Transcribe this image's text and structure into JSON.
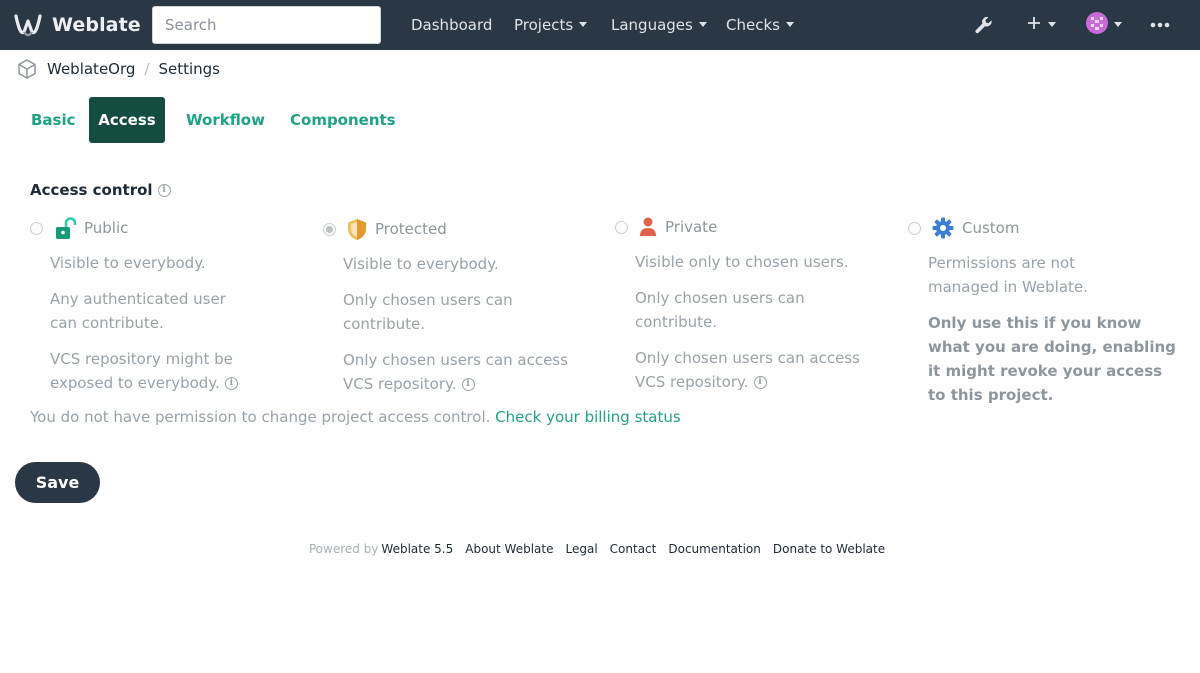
{
  "app": {
    "name": "Weblate",
    "logo_icon": "weblate-logo-icon"
  },
  "navbar": {
    "search": {
      "placeholder": "Search"
    },
    "links": [
      {
        "label": "Dashboard",
        "dropdown": false
      },
      {
        "label": "Projects",
        "dropdown": true
      },
      {
        "label": "Languages",
        "dropdown": true
      },
      {
        "label": "Checks",
        "dropdown": true
      }
    ],
    "icons": [
      "wrench-icon",
      "plus-icon",
      "avatar-icon",
      "more-icon"
    ]
  },
  "breadcrumb": {
    "icon": "project-icon",
    "project": "WeblateOrg",
    "page": "Settings"
  },
  "tabs": [
    {
      "label": "Basic",
      "active": false
    },
    {
      "label": "Access",
      "active": true
    },
    {
      "label": "Workflow",
      "active": false
    },
    {
      "label": "Components",
      "active": false
    }
  ],
  "access": {
    "title": "Access control",
    "options": [
      {
        "label": "Public",
        "icon": "unlock-icon",
        "icon_color": "#2eccaa",
        "checked": false,
        "lines": [
          "Visible to everybody.",
          "Any authenticated user can contribute.",
          "VCS repository might be exposed to everybody."
        ]
      },
      {
        "label": "Protected",
        "icon": "shield-icon",
        "icon_color": "#e4a93c",
        "checked": true,
        "lines": [
          "Visible to everybody.",
          "Only chosen users can contribute.",
          "Only chosen users can access VCS repository."
        ]
      },
      {
        "label": "Private",
        "icon": "user-icon",
        "icon_color": "#e0624a",
        "checked": false,
        "lines": [
          "Visible only to chosen users.",
          "Only chosen users can contribute.",
          "Only chosen users can access VCS repository."
        ]
      },
      {
        "label": "Custom",
        "icon": "gear-icon",
        "icon_color": "#3e7fd6",
        "checked": false,
        "lines": [
          "Permissions are not managed in Weblate."
        ],
        "warning": "Only use this if you know what you are doing, enabling it might revoke your access to this project."
      }
    ],
    "permission_note": "You do not have permission to change project access control.",
    "billing_link": "Check your billing status",
    "save_label": "Save"
  },
  "footer": {
    "powered_by": "Powered by",
    "links": [
      "Weblate 5.5",
      "About Weblate",
      "Legal",
      "Contact",
      "Documentation",
      "Donate to Weblate"
    ]
  },
  "colors": {
    "navbar": "#2a3744",
    "accent": "#1fa385",
    "active_tab": "#144d3f"
  }
}
